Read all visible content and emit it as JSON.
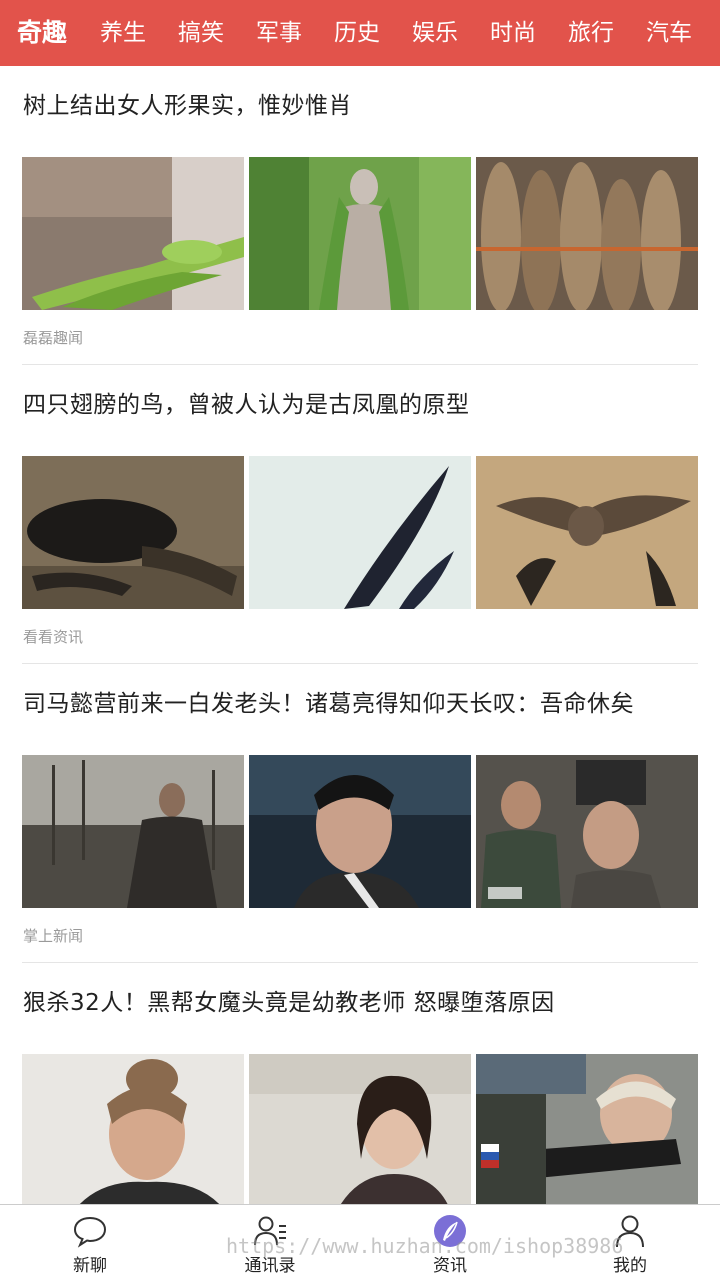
{
  "topbar": {
    "bg_color": "#e2534b",
    "tabs": [
      "奇趣",
      "养生",
      "搞笑",
      "军事",
      "历史",
      "娱乐",
      "时尚",
      "旅行",
      "汽车"
    ]
  },
  "articles": [
    {
      "title": "树上结出女人形果实，惟妙惟肖",
      "source": "磊磊趣闻"
    },
    {
      "title": "四只翅膀的鸟，曾被人认为是古凤凰的原型",
      "source": "看看资讯"
    },
    {
      "title": "司马懿营前来一白发老头！诸葛亮得知仰天长叹：吾命休矣",
      "source": "掌上新闻"
    },
    {
      "title": "狠杀32人！黑帮女魔头竟是幼教老师 怒曝堕落原因",
      "source": ""
    }
  ],
  "bottom_nav": [
    {
      "label": "新聊",
      "icon": "chat-bubble-icon"
    },
    {
      "label": "通讯录",
      "icon": "contacts-icon"
    },
    {
      "label": "资讯",
      "icon": "compass-feather-icon",
      "active": true,
      "accent": "#7b6fd6"
    },
    {
      "label": "我的",
      "icon": "person-icon"
    }
  ],
  "watermark": "https://www.huzhan.com/ishop38986"
}
